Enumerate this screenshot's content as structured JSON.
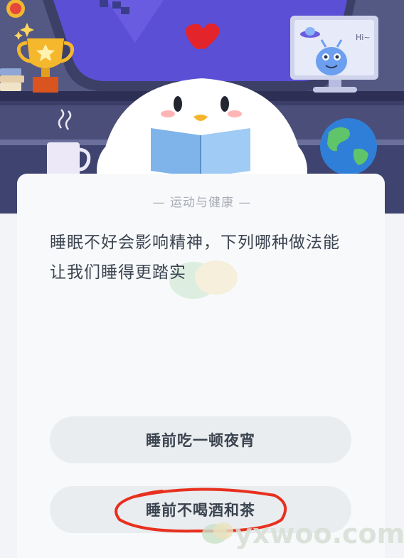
{
  "category": "— 运动与健康 —",
  "question": "睡眠不好会影响精神，下列哪种做法能让我们睡得更踏实",
  "options": [
    {
      "label": "睡前吃一顿夜宵"
    },
    {
      "label": "睡前不喝酒和茶"
    }
  ],
  "monitor_bubble": "Hi~",
  "watermark": "yxwoo.com",
  "icons": [
    "trophy-icon",
    "penguin-badge-icon",
    "mug-icon",
    "books-icon",
    "globe-icon",
    "alien-icon",
    "ufo-icon",
    "sparkle-icon"
  ],
  "colors": {
    "scene_bg": "#4a4f7a",
    "screen": "#5b4fd6",
    "card": "#f8f9fb",
    "option_bg": "#e9edf0",
    "highlight_circle": "#e8301e"
  }
}
